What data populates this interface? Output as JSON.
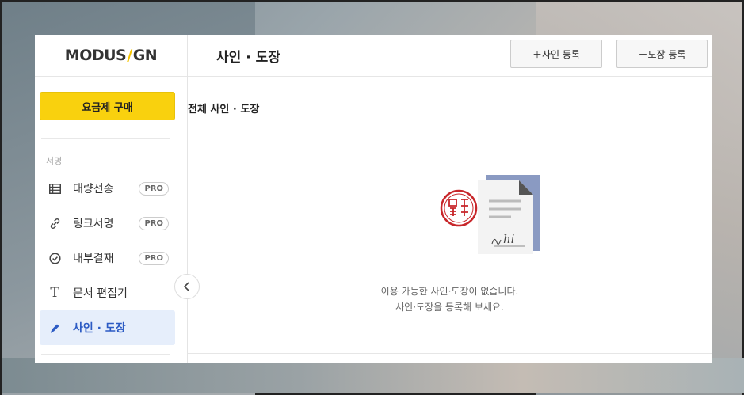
{
  "logo": {
    "left": "MODUS",
    "slash": "/",
    "right": "GN"
  },
  "sidebar": {
    "plan_button": "요금제 구매",
    "section_label": "서명",
    "items": [
      {
        "label": "대량전송",
        "badge": "PRO",
        "icon": "table-icon"
      },
      {
        "label": "링크서명",
        "badge": "PRO",
        "icon": "link-icon"
      },
      {
        "label": "내부결재",
        "badge": "PRO",
        "icon": "check-circle-icon"
      },
      {
        "label": "문서 편집기",
        "badge": "",
        "icon": "text-icon"
      },
      {
        "label": "사인 · 도장",
        "badge": "",
        "icon": "pen-icon"
      }
    ],
    "collapse_icon": "chevron-left-icon"
  },
  "header": {
    "title": "사인 · 도장",
    "add_sign_button": "＋사인 등록",
    "add_seal_button": "＋도장 등록"
  },
  "subheader": {
    "label": "전체 사인 · 도장"
  },
  "empty_state": {
    "line1": "이용 가능한 사인·도장이 없습니다.",
    "line2": "사인·도장을 등록해 보세요.",
    "signature_text": "hi"
  },
  "colors": {
    "accent_yellow": "#f9d10e",
    "active_blue": "#2c5bc4",
    "active_bg": "#e6eefb",
    "seal_red": "#c8262a",
    "doc_blue": "#8a9ac2"
  }
}
